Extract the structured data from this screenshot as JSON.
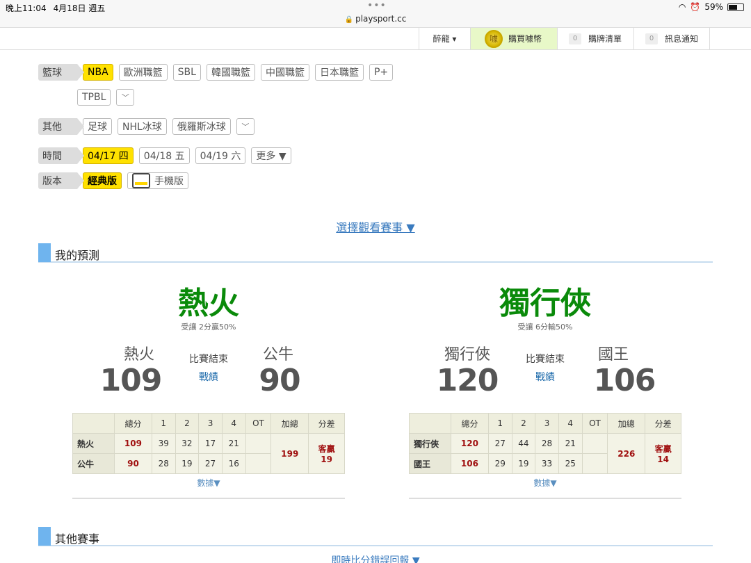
{
  "status": {
    "time": "晚上11:04",
    "date": "4月18日 週五",
    "url": "playsport.cc",
    "battery": "59%",
    "battery_level": 0.59
  },
  "topbar": {
    "user": "醉龍 ▾",
    "buy": "購買噱幣",
    "coin": "噱",
    "cart_count": "0",
    "cart": "購牌清單",
    "msg_count": "0",
    "msg": "訊息通知"
  },
  "filters": {
    "basketball": {
      "label": "籃球",
      "items": [
        "NBA",
        "歐洲職籃",
        "SBL",
        "韓國職籃",
        "中國職籃",
        "日本職籃",
        "P+"
      ],
      "items2": [
        "TPBL"
      ]
    },
    "other": {
      "label": "其他",
      "items": [
        "足球",
        "NHL冰球",
        "俄羅斯冰球"
      ]
    },
    "time": {
      "label": "時間",
      "items": [
        "04/17 四",
        "04/18 五",
        "04/19 六",
        "更多 ▼"
      ]
    },
    "version": {
      "label": "版本",
      "classic": "經典版",
      "mobile": "手機版"
    }
  },
  "select_link": "選擇觀看賽事 ▼",
  "sections": {
    "mine": "我的預測",
    "others": "其他賽事"
  },
  "games": [
    {
      "pick": "熱火",
      "spread": "受讓 2分贏50%",
      "away": "熱火",
      "home": "公牛",
      "away_score": "109",
      "home_score": "90",
      "status": "比賽結束",
      "link": "戰績",
      "headers": [
        "總分",
        "1",
        "2",
        "3",
        "4",
        "OT",
        "加總",
        "分差"
      ],
      "rows": [
        {
          "team": "熱火",
          "total": "109",
          "q": [
            "39",
            "32",
            "17",
            "21",
            ""
          ]
        },
        {
          "team": "公牛",
          "total": "90",
          "q": [
            "28",
            "19",
            "27",
            "16",
            ""
          ]
        }
      ],
      "sum": "199",
      "diff1": "客贏",
      "diff2": "19",
      "data": "數據▼"
    },
    {
      "pick": "獨行俠",
      "spread": "受讓 6分輸50%",
      "away": "獨行俠",
      "home": "國王",
      "away_score": "120",
      "home_score": "106",
      "status": "比賽結束",
      "link": "戰績",
      "headers": [
        "總分",
        "1",
        "2",
        "3",
        "4",
        "OT",
        "加總",
        "分差"
      ],
      "rows": [
        {
          "team": "獨行俠",
          "total": "120",
          "q": [
            "27",
            "44",
            "28",
            "21",
            ""
          ]
        },
        {
          "team": "國王",
          "total": "106",
          "q": [
            "29",
            "19",
            "33",
            "25",
            ""
          ]
        }
      ],
      "sum": "226",
      "diff1": "客贏",
      "diff2": "14",
      "data": "數據▼"
    }
  ],
  "bottom_link": "即時比分錯誤回報 ▼"
}
